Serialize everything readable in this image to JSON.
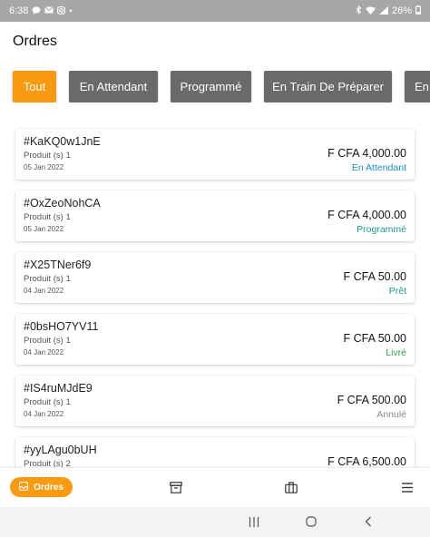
{
  "status_bar": {
    "time": "6:38",
    "battery": "26%"
  },
  "header": {
    "title": "Ordres"
  },
  "tabs": [
    {
      "label": "Tout",
      "active": true
    },
    {
      "label": "En Attendant",
      "active": false
    },
    {
      "label": "Programmé",
      "active": false
    },
    {
      "label": "En Train De Préparer",
      "active": false
    },
    {
      "label": "En",
      "active": false
    }
  ],
  "orders": [
    {
      "id": "#KaKQ0w1JnE",
      "products": "Produit (s) 1",
      "date": "05 Jan 2022",
      "amount": "F CFA 4,000.00",
      "status": "En Attendant",
      "status_color": "#1b8fc2"
    },
    {
      "id": "#OxZeoNohCA",
      "products": "Produit (s) 1",
      "date": "05 Jan 2022",
      "amount": "F CFA 4,000.00",
      "status": "Programmé",
      "status_color": "#1a9a8e"
    },
    {
      "id": "#X25TNer6f9",
      "products": "Produit (s) 1",
      "date": "04 Jan 2022",
      "amount": "F CFA 50.00",
      "status": "Prêt",
      "status_color": "#1a9a8e"
    },
    {
      "id": "#0bsHO7YV11",
      "products": "Produit (s) 1",
      "date": "04 Jan 2022",
      "amount": "F CFA 50.00",
      "status": "Livré",
      "status_color": "#2f9d4a"
    },
    {
      "id": "#IS4ruMJdE9",
      "products": "Produit (s) 1",
      "date": "04 Jan 2022",
      "amount": "F CFA 500.00",
      "status": "Annulé",
      "status_color": "#8a8a8a"
    },
    {
      "id": "#yyLAgu0bUH",
      "products": "Produit (s) 2",
      "date": "",
      "amount": "F CFA 6,500.00",
      "status": "",
      "status_color": "#8a8a8a"
    }
  ],
  "bottom_nav": {
    "orders_label": "Ordres",
    "icons": [
      "archive-icon",
      "briefcase-icon",
      "menu-icon"
    ]
  },
  "colors": {
    "accent": "#f99a10",
    "tab_inactive": "#6a6a6a"
  }
}
